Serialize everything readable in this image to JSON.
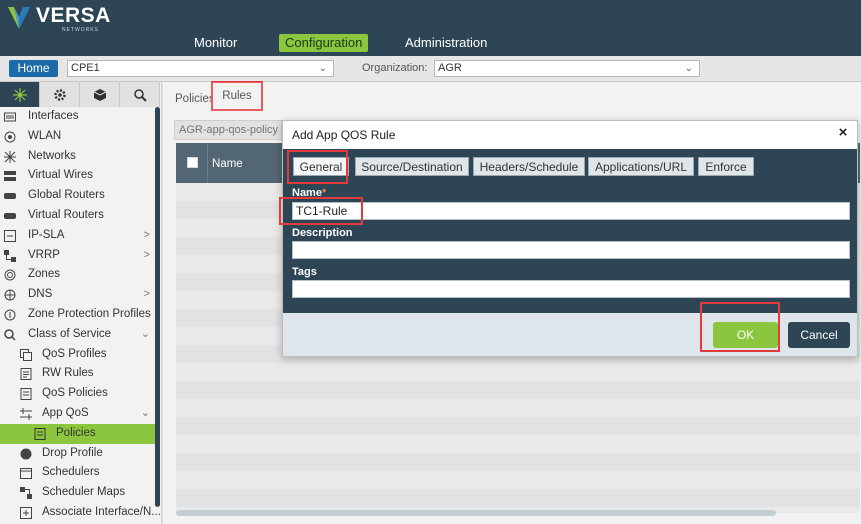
{
  "brand": {
    "name": "VERSA",
    "sub": "NETWORKS",
    "colors": {
      "navy": "#2e4555",
      "green": "#8cc63f",
      "blue": "#1c6aa8",
      "highlight": "#e33b3b"
    }
  },
  "topnav": {
    "items": [
      "Monitor",
      "Configuration",
      "Administration"
    ],
    "active": "Configuration"
  },
  "subbar": {
    "home_label": "Home",
    "appliance_value": "CPE1",
    "org_label": "Organization:",
    "org_value": "AGR"
  },
  "sidebar": {
    "tabs": [
      "network-icon",
      "gear-icon",
      "cube-icon",
      "objects-icon"
    ],
    "items": [
      {
        "label": "Interfaces",
        "icon": "interfaces-icon"
      },
      {
        "label": "WLAN",
        "icon": "wifi-icon"
      },
      {
        "label": "Networks",
        "icon": "networks-icon"
      },
      {
        "label": "Virtual Wires",
        "icon": "wires-icon"
      },
      {
        "label": "Global Routers",
        "icon": "router-icon"
      },
      {
        "label": "Virtual Routers",
        "icon": "router-icon"
      },
      {
        "label": "IP-SLA",
        "icon": "ipsla-icon",
        "chevron": ">"
      },
      {
        "label": "VRRP",
        "icon": "vrrp-icon",
        "chevron": ">"
      },
      {
        "label": "Zones",
        "icon": "zones-icon"
      },
      {
        "label": "DNS",
        "icon": "dns-icon",
        "chevron": ">"
      },
      {
        "label": "Zone Protection Profiles",
        "icon": "zone-protection-icon"
      },
      {
        "label": "Class of Service",
        "icon": "cos-icon",
        "chevron": "⌄"
      },
      {
        "label": "QoS Profiles",
        "icon": "qos-profiles-icon"
      },
      {
        "label": "RW Rules",
        "icon": "rw-rules-icon"
      },
      {
        "label": "QoS Policies",
        "icon": "qos-policies-icon"
      },
      {
        "label": "App QoS",
        "icon": "app-qos-icon",
        "chevron": "⌄"
      },
      {
        "label": "Policies",
        "icon": "policies-icon",
        "active": true
      },
      {
        "label": "Drop Profile",
        "icon": "drop-profile-icon"
      },
      {
        "label": "Schedulers",
        "icon": "schedulers-icon"
      },
      {
        "label": "Scheduler Maps",
        "icon": "scheduler-maps-icon"
      },
      {
        "label": "Associate Interface/N...",
        "icon": "associate-icon"
      }
    ]
  },
  "main": {
    "breadcrumb_policies": "Policies",
    "breadcrumb_rules": "Rules",
    "policy_tab": "AGR-app-qos-policy",
    "grid_name_header": "Name"
  },
  "modal": {
    "title": "Add App QOS Rule",
    "close": "×",
    "tabs": [
      "General",
      "Source/Destination",
      "Headers/Schedule",
      "Applications/URL",
      "Enforce"
    ],
    "active_tab": "General",
    "fields": {
      "name_label": "Name",
      "name_required": "*",
      "name_value": "TC1-Rule",
      "description_label": "Description",
      "description_value": "",
      "tags_label": "Tags",
      "tags_value": ""
    },
    "ok_label": "OK",
    "cancel_label": "Cancel"
  }
}
